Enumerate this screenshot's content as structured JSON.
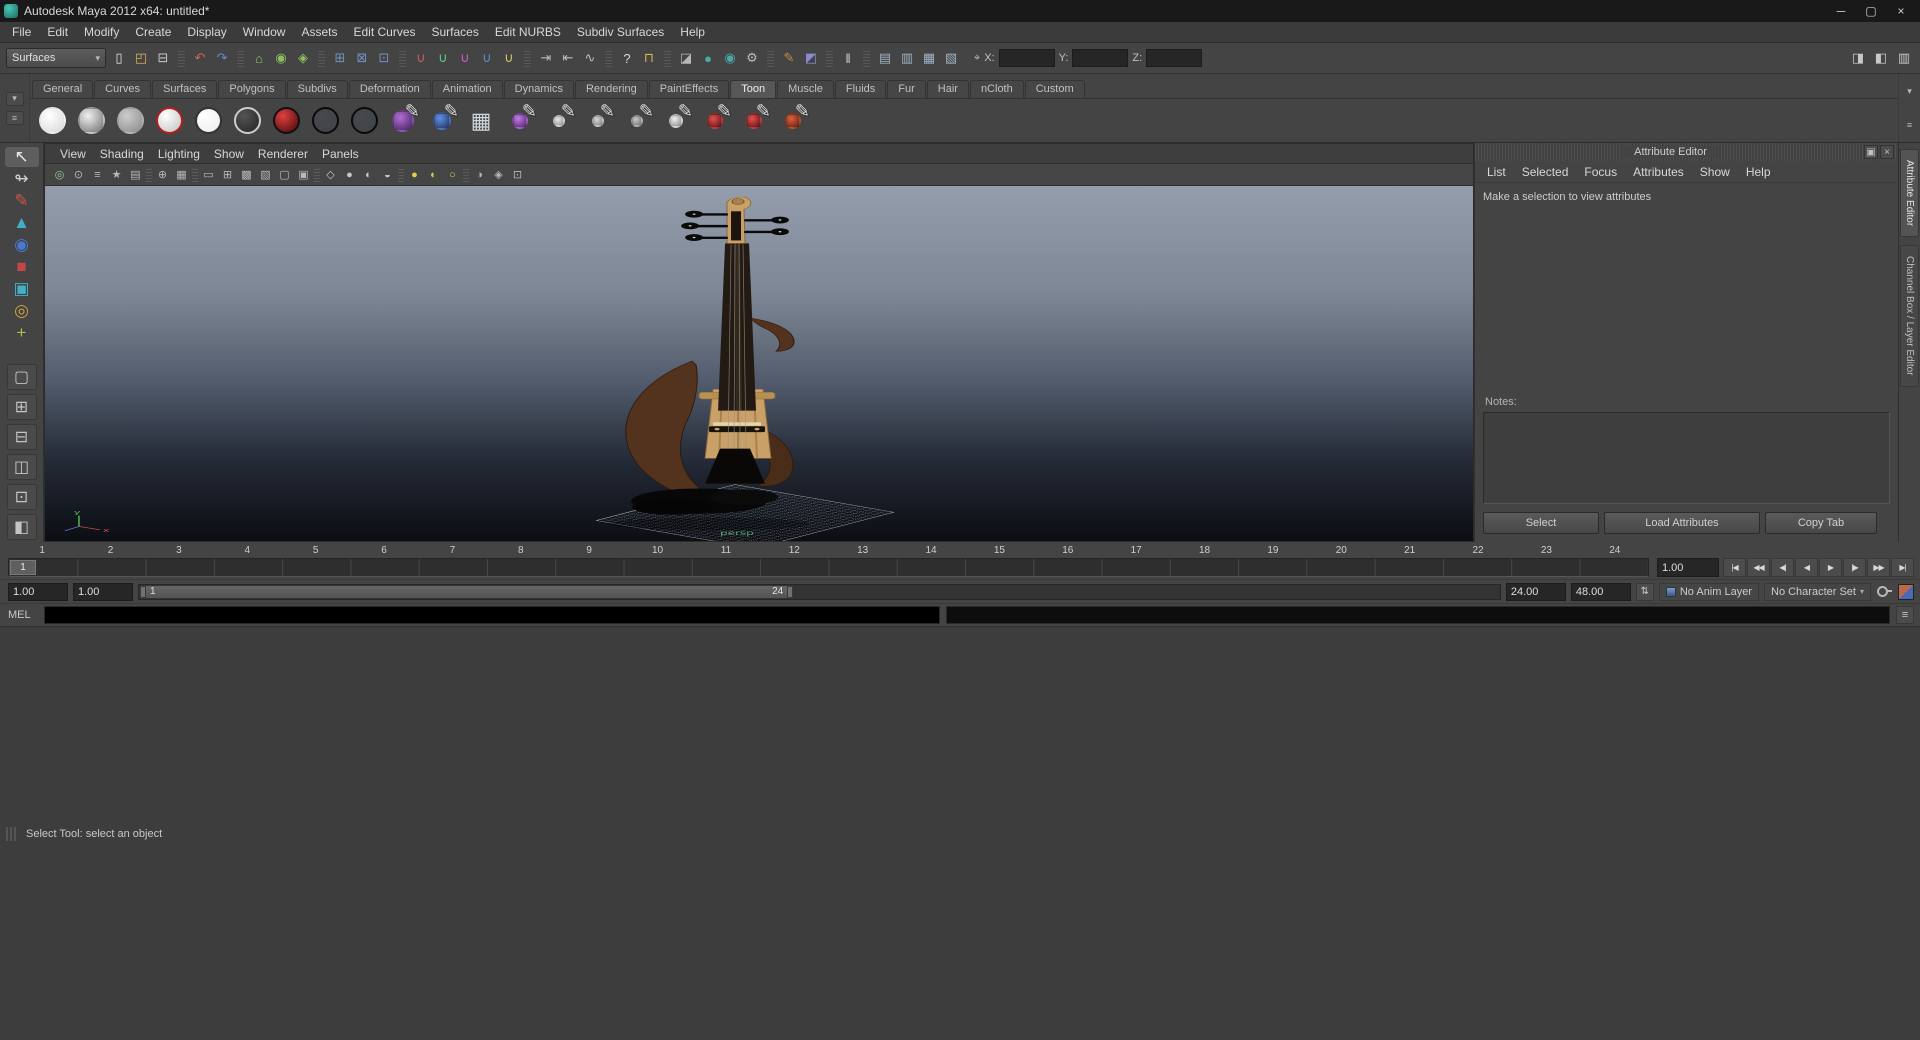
{
  "window": {
    "title": "Autodesk Maya 2012 x64: untitled*"
  },
  "icons": {
    "minimize": "─",
    "maximize": "▢",
    "close": "×",
    "dropdown_arrow": "▾",
    "entry_mode": "⌖",
    "panel_float": "▣",
    "panel_close": "×",
    "shelf_arrow": "▾",
    "shelf_menu": "≡",
    "shelf_side_top": "▾",
    "shelf_side_bottom": "≡",
    "range_updown": "⇅",
    "mel_icon": "≡",
    "toolbox_bottom": "◎"
  },
  "menubar": {
    "items": [
      "File",
      "Edit",
      "Modify",
      "Create",
      "Display",
      "Window",
      "Assets",
      "Edit Curves",
      "Surfaces",
      "Edit NURBS",
      "Subdiv Surfaces",
      "Help"
    ]
  },
  "toolbar": {
    "mode_selector": "Surfaces",
    "x_label": "X:",
    "y_label": "Y:",
    "z_label": "Z:",
    "x_value": "",
    "y_value": "",
    "z_value": "",
    "icons": [
      {
        "name": "new-scene-icon",
        "glyph": "▯",
        "color": "#e0e0e0"
      },
      {
        "name": "open-scene-icon",
        "glyph": "◰",
        "color": "#d9b35c"
      },
      {
        "name": "save-scene-icon",
        "glyph": "⊟",
        "color": "#c8c8c8"
      },
      {
        "name": "toolbar-group-separator",
        "glyph": ""
      },
      {
        "name": "undo-icon",
        "glyph": "↶",
        "color": "#cc6655"
      },
      {
        "name": "redo-icon",
        "glyph": "↷",
        "color": "#6688cc"
      },
      {
        "name": "toolbar-group-separator",
        "glyph": ""
      },
      {
        "name": "select-hierarchy-icon",
        "glyph": "⌂",
        "color": "#8fbf5f"
      },
      {
        "name": "select-object-icon",
        "glyph": "◉",
        "color": "#8fbf5f"
      },
      {
        "name": "select-component-icon",
        "glyph": "◈",
        "color": "#8fbf5f"
      },
      {
        "name": "toolbar-group-separator",
        "glyph": ""
      },
      {
        "name": "select-mask-mesh-icon",
        "glyph": "⊞",
        "color": "#6f93bc"
      },
      {
        "name": "select-mask-curve-icon",
        "glyph": "⊠",
        "color": "#6f93bc"
      },
      {
        "name": "select-mask-surface-icon",
        "glyph": "⊡",
        "color": "#6f93bc"
      },
      {
        "name": "toolbar-group-separator",
        "glyph": ""
      },
      {
        "name": "snap-to-grids-icon",
        "glyph": "∪",
        "color": "#cf5f5f"
      },
      {
        "name": "sn ap-to-curves-icon",
        "glyph": "∪",
        "color": "#5fcf8f"
      },
      {
        "name": "snap-to-points-icon",
        "glyph": "∪",
        "color": "#cf5fcf"
      },
      {
        "name": "snap-to-view-planes-icon",
        "glyph": "∪",
        "color": "#5f8fcf"
      },
      {
        "name": "make-live-icon",
        "glyph": "∪",
        "color": "#cfcf5f"
      },
      {
        "name": "toolbar-group-separator",
        "glyph": ""
      },
      {
        "name": "input-connections-icon",
        "glyph": "⇥",
        "color": "#bcbcbc"
      },
      {
        "name": "output-connections-icon",
        "glyph": "⇤",
        "color": "#bcbcbc"
      },
      {
        "name": "construction-history-icon",
        "glyph": "∿",
        "color": "#bcbcbc"
      },
      {
        "name": "toolbar-group-separator",
        "glyph": ""
      },
      {
        "name": "quick-help-icon",
        "glyph": "?",
        "color": "#d8d8d8"
      },
      {
        "name": "lock-selection-icon",
        "glyph": "⊓",
        "color": "#d8b84a"
      },
      {
        "name": "toolbar-group-separator",
        "glyph": ""
      },
      {
        "name": "render-view-icon",
        "glyph": "◪",
        "color": "#b8b8b8"
      },
      {
        "name": "render-current-frame-icon",
        "glyph": "●",
        "color": "#49a8a8"
      },
      {
        "name": "ipr-render-icon",
        "glyph": "◉",
        "color": "#49a8a8"
      },
      {
        "name": "render-settings-icon",
        "glyph": "⚙",
        "color": "#b8b8b8"
      },
      {
        "name": "toolbar-group-separator",
        "glyph": ""
      },
      {
        "name": "paint-effects-panel-icon",
        "glyph": "✎",
        "color": "#cc8a4a"
      },
      {
        "name": "hypershade-icon",
        "glyph": "◩",
        "color": "#8a8acc"
      },
      {
        "name": "toolbar-group-separator",
        "glyph": ""
      },
      {
        "name": "interactive-playback-icon",
        "glyph": "‖",
        "color": "#d0d0d0"
      },
      {
        "name": "toolbar-group-separator",
        "glyph": ""
      },
      {
        "name": "hypergraph-icon",
        "glyph": "▤",
        "color": "#9fb2c4"
      },
      {
        "name": "outliner-icon",
        "glyph": "▥",
        "color": "#9fb2c4"
      },
      {
        "name": "graph-editor-icon",
        "glyph": "▦",
        "color": "#9fb2c4"
      },
      {
        "name": "component-editor-icon",
        "glyph": "▧",
        "color": "#9fb2c4"
      }
    ],
    "right_icons": [
      {
        "name": "toggle-attribute-editor-icon",
        "glyph": "◨",
        "color": "#c8c8c8"
      },
      {
        "name": "toggle-tool-settings-icon",
        "glyph": "◧",
        "color": "#c8c8c8"
      },
      {
        "name": "toggle-channel-box-icon",
        "glyph": "▥",
        "color": "#c8c8c8"
      }
    ]
  },
  "shelf": {
    "active_tab": "Toon",
    "tabs": [
      "General",
      "Curves",
      "Surfaces",
      "Polygons",
      "Subdivs",
      "Deformation",
      "Animation",
      "Dynamics",
      "Rendering",
      "PaintEffects",
      "Toon",
      "Muscle",
      "Fluids",
      "Fur",
      "Hair",
      "nCloth",
      "Custom"
    ],
    "items": [
      {
        "name": "toon-shelf-solid-white-ball",
        "style": {
          "--c1": "#ffffff",
          "--c2": "#d8d8d8"
        }
      },
      {
        "name": "toon-shelf-shaded-ball",
        "style": {
          "--c1": "#f0f0f0",
          "--c2": "#6e6e6e"
        }
      },
      {
        "name": "toon-shelf-gray-ball",
        "style": {
          "--c1": "#cccccc",
          "--c2": "#8a8a8a"
        }
      },
      {
        "name": "toon-shelf-red-rim-ball",
        "style": {
          "--c1": "#ffffff",
          "--c2": "#c0c0c0",
          "--bd": "#b02020"
        }
      },
      {
        "name": "toon-shelf-flat-white-ball",
        "style": {
          "--c1": "#ffffff",
          "--c2": "#ececec",
          "--bd": "#333333"
        }
      },
      {
        "name": "toon-shelf-dark-ring-ball",
        "style": {
          "--c1": "#555555",
          "--c2": "#222222",
          "--bd": "#cccccc"
        }
      },
      {
        "name": "toon-shelf-red-ball",
        "style": {
          "--c1": "#e04040",
          "--c2": "#400808",
          "--bd": "#111111"
        }
      },
      {
        "name": "toon-shelf-outline-ball-1",
        "style": {
          "--c1": "#46484c",
          "--c2": "#404348",
          "--bd": "#0a0a0a"
        }
      },
      {
        "name": "toon-shelf-outline-ball-2",
        "style": {
          "--c1": "#46484c",
          "--c2": "#404348",
          "--bd": "#0a0a0a"
        }
      },
      {
        "name": "toon-shelf-purple-ball-brush",
        "pen": "✎",
        "style": {
          "--c1": "#b070d0",
          "--c2": "#402060",
          "--size": "22px"
        }
      },
      {
        "name": "toon-shelf-blue-ball-brush",
        "pen": "✎",
        "style": {
          "--c1": "#6090e0",
          "--c2": "#203060",
          "--size": "18px"
        }
      },
      {
        "name": "toon-shelf-modifier-grid",
        "glyph": "▦",
        "style": {
          "--size": "0px"
        }
      },
      {
        "name": "toon-shelf-purple-sparkle-brush",
        "pen": "✎",
        "style": {
          "--c1": "#c080e0",
          "--c2": "#502070",
          "--size": "16px"
        }
      },
      {
        "name": "toon-shelf-stroke-brush-1",
        "pen": "✎",
        "style": {
          "--c1": "#e8e8e8",
          "--c2": "#909090",
          "--size": "12px"
        }
      },
      {
        "name": "toon-shelf-stroke-brush-2",
        "pen": "✎",
        "style": {
          "--c1": "#d8d8d8",
          "--c2": "#808080",
          "--size": "12px"
        }
      },
      {
        "name": "toon-shelf-stroke-brush-3",
        "pen": "✎",
        "style": {
          "--c1": "#c8c8c8",
          "--c2": "#707070",
          "--size": "12px"
        }
      },
      {
        "name": "toon-shelf-ball-brush-small",
        "pen": "✎",
        "style": {
          "--c1": "#f0f0f0",
          "--c2": "#888888",
          "--size": "14px"
        }
      },
      {
        "name": "toon-shelf-red-brush-1",
        "pen": "✎",
        "style": {
          "--c1": "#e05050",
          "--c2": "#5a1010",
          "--size": "16px"
        }
      },
      {
        "name": "toon-shelf-red-brush-2",
        "pen": "✎",
        "style": {
          "--c1": "#e05050",
          "--c2": "#5a1010",
          "--size": "16px"
        }
      },
      {
        "name": "toon-shelf-red-brush-3",
        "pen": "✎",
        "style": {
          "--c1": "#e06040",
          "--c2": "#5a2010",
          "--size": "16px"
        }
      }
    ]
  },
  "toolbox": {
    "tools": [
      {
        "name": "select-tool",
        "glyph": "↖",
        "color": "#e8e8e8",
        "style": {
          "--bg": "#5e5e5e"
        }
      },
      {
        "name": "lasso-tool",
        "glyph": "↬",
        "color": "#d0d0d0"
      },
      {
        "name": "paint-select-tool",
        "glyph": "✎",
        "color": "#cc5544"
      },
      {
        "name": "move-tool",
        "glyph": "▲",
        "color": "#3fb0c8"
      },
      {
        "name": "rotate-tool",
        "glyph": "◉",
        "color": "#4a78d0"
      },
      {
        "name": "scale-tool",
        "glyph": "■",
        "color": "#c04848"
      },
      {
        "name": "universal-manipulator-tool",
        "glyph": "▣",
        "color": "#3fb0c8"
      },
      {
        "name": "soft-mod-tool",
        "glyph": "◎",
        "color": "#d0a040"
      },
      {
        "name": "show-manipulator-tool",
        "glyph": "+",
        "color": "#a8c050"
      },
      {
        "name": "last-tool-slot",
        "glyph": "",
        "color": "#888888"
      }
    ],
    "layouts": [
      {
        "name": "layout-single-pane",
        "glyph": "▢"
      },
      {
        "name": "layout-four-pane",
        "glyph": "⊞"
      },
      {
        "name": "layout-two-pane-stacked",
        "glyph": "⊟"
      },
      {
        "name": "layout-two-pane-side",
        "glyph": "◫"
      },
      {
        "name": "layout-three-pane",
        "glyph": "⊡"
      },
      {
        "name": "layout-outliner-persp",
        "glyph": "◧"
      },
      {
        "name": "layout-menu-arrow",
        "glyph": "▾"
      }
    ]
  },
  "viewport": {
    "menu": [
      "View",
      "Shading",
      "Lighting",
      "Show",
      "Renderer",
      "Panels"
    ],
    "camera_label": "persp",
    "axis_x": "x",
    "axis_y": "y",
    "icons": [
      {
        "name": "select-camera-icon",
        "glyph": "◎",
        "color": "#9fc49f"
      },
      {
        "name": "lock-camera-icon",
        "glyph": "⊙",
        "color": "#c4b89f"
      },
      {
        "name": "camera-attributes-icon",
        "glyph": "≡",
        "color": "#b8b8b8"
      },
      {
        "name": "bookmarks-icon",
        "glyph": "★",
        "color": "#b8b8b8"
      },
      {
        "name": "image-plane-icon",
        "glyph": "▤",
        "color": "#b8b8b8"
      },
      {
        "name": "viewport-separator",
        "glyph": ""
      },
      {
        "name": "2d-pan-zoom-icon",
        "glyph": "⊕",
        "color": "#b8b8b8"
      },
      {
        "name": "oversampling-icon",
        "glyph": "▦",
        "color": "#b8b8b8"
      },
      {
        "name": "viewport-separator",
        "glyph": ""
      },
      {
        "name": "film-gate-icon",
        "glyph": "▭",
        "color": "#b8b8b8"
      },
      {
        "name": "resolution-gate-icon",
        "glyph": "⊞",
        "color": "#b8b8b8"
      },
      {
        "name": "gate-mask-icon",
        "glyph": "▩",
        "color": "#b8b8b8"
      },
      {
        "name": "field-chart-icon",
        "glyph": "▧",
        "color": "#b8b8b8"
      },
      {
        "name": "safe-action-icon",
        "glyph": "▢",
        "color": "#b8b8b8"
      },
      {
        "name": "safe-title-icon",
        "glyph": "▣",
        "color": "#b8b8b8"
      },
      {
        "name": "viewport-separator",
        "glyph": ""
      },
      {
        "name": "wireframe-icon",
        "glyph": "◇",
        "color": "#c8c8c8"
      },
      {
        "name": "smooth-shade-icon",
        "glyph": "●",
        "color": "#c8c8c8"
      },
      {
        "name": "textured-icon",
        "glyph": "◐",
        "color": "#c8c8c8"
      },
      {
        "name": "use-default-material-icon",
        "glyph": "◒",
        "color": "#c8c8c8"
      },
      {
        "name": "viewport-separator",
        "glyph": ""
      },
      {
        "name": "use-all-lights-icon",
        "glyph": "●",
        "color": "#e2cc4e"
      },
      {
        "name": "use-selected-lights-icon",
        "glyph": "◐",
        "color": "#e2cc4e"
      },
      {
        "name": "use-no-lights-icon",
        "glyph": "○",
        "color": "#e2cc4e"
      },
      {
        "name": "viewport-separator",
        "glyph": ""
      },
      {
        "name": "shadows-icon",
        "glyph": "◑",
        "color": "#b8b8b8"
      },
      {
        "name": "xray-icon",
        "glyph": "◈",
        "color": "#b8b8b8"
      },
      {
        "name": "isolate-select-icon",
        "glyph": "⊡",
        "color": "#b8b8b8"
      }
    ]
  },
  "attribute_editor": {
    "title": "Attribute Editor",
    "menu": [
      "List",
      "Selected",
      "Focus",
      "Attributes",
      "Show",
      "Help"
    ],
    "message": "Make a selection to view attributes",
    "notes_label": "Notes:",
    "buttons": [
      {
        "name": "select-button",
        "label": "Select"
      },
      {
        "name": "load-attributes-button",
        "label": "Load Attributes"
      },
      {
        "name": "copy-tab-button",
        "label": "Copy Tab"
      }
    ]
  },
  "side_tabs": {
    "top": "Attribute Editor",
    "bottom": "Channel Box / Layer Editor"
  },
  "timeline": {
    "ticks": [
      "1",
      "2",
      "3",
      "4",
      "5",
      "6",
      "7",
      "8",
      "9",
      "10",
      "11",
      "12",
      "13",
      "14",
      "15",
      "16",
      "17",
      "18",
      "19",
      "20",
      "21",
      "22",
      "23",
      "24"
    ],
    "current_frame": "1",
    "current_time_field": "1.00",
    "playback": [
      {
        "name": "go-to-start-button",
        "glyph": "|◀"
      },
      {
        "name": "step-back-frame-button",
        "glyph": "◀◀"
      },
      {
        "name": "step-back-key-button",
        "glyph": "◀|"
      },
      {
        "name": "play-backwards-button",
        "glyph": "◀"
      },
      {
        "name": "play-forwards-button",
        "glyph": "▶"
      },
      {
        "name": "step-forward-key-button",
        "glyph": "|▶"
      },
      {
        "name": "step-forward-frame-button",
        "glyph": "▶▶"
      },
      {
        "name": "go-to-end-button",
        "glyph": "▶|"
      }
    ]
  },
  "range_slider": {
    "start_field": "1.00",
    "min_field": "1.00",
    "range_start": "1",
    "range_end": "24",
    "end_field": "24.00",
    "max_field": "48.00",
    "anim_layer": "No Anim Layer",
    "character_set": "No Character Set"
  },
  "command_line": {
    "label": "MEL"
  },
  "help_line": {
    "text": "Select Tool: select an object"
  },
  "colors": {
    "ui_bg": "#444444",
    "titlebar_bg": "#191919",
    "viewport_top": "#939dab",
    "viewport_bottom": "#0b0e13",
    "wood_light": "#c9a168",
    "wood_dark": "#53331d"
  }
}
